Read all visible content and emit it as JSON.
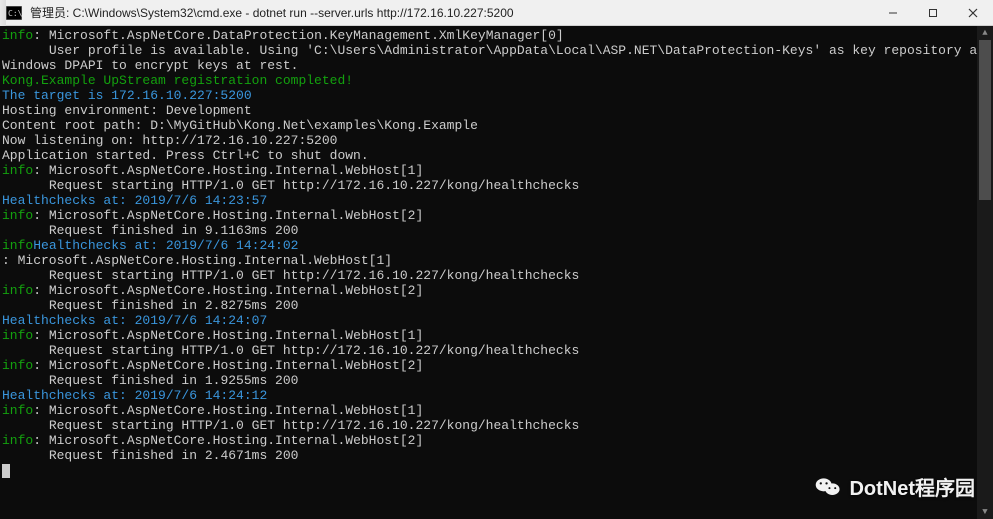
{
  "title": "管理员: C:\\Windows\\System32\\cmd.exe - dotnet  run --server.urls http://172.16.10.227:5200",
  "watermark": "DotNet程序园",
  "lines": [
    {
      "segments": [
        {
          "cls": "lvl-info",
          "txt": "info"
        },
        {
          "cls": "gray",
          "txt": ": Microsoft.AspNetCore.DataProtection.KeyManagement.XmlKeyManager[0]"
        }
      ]
    },
    {
      "segments": [
        {
          "cls": "gray",
          "txt": "      User profile is available. Using 'C:\\Users\\Administrator\\AppData\\Local\\ASP.NET\\DataProtection-Keys' as key repository and Windows DPAPI to encrypt keys at rest."
        }
      ]
    },
    {
      "segments": [
        {
          "cls": "kong-green",
          "txt": "Kong.Example UpStream registration completed!"
        }
      ]
    },
    {
      "segments": [
        {
          "cls": "hc-cyan",
          "txt": "The target is 172.16.10.227:5200"
        }
      ]
    },
    {
      "segments": [
        {
          "cls": "gray",
          "txt": "Hosting environment: Development"
        }
      ]
    },
    {
      "segments": [
        {
          "cls": "gray",
          "txt": "Content root path: D:\\MyGitHub\\Kong.Net\\examples\\Kong.Example"
        }
      ]
    },
    {
      "segments": [
        {
          "cls": "gray",
          "txt": "Now listening on: http://172.16.10.227:5200"
        }
      ]
    },
    {
      "segments": [
        {
          "cls": "gray",
          "txt": "Application started. Press Ctrl+C to shut down."
        }
      ]
    },
    {
      "segments": [
        {
          "cls": "lvl-info",
          "txt": "info"
        },
        {
          "cls": "gray",
          "txt": ": Microsoft.AspNetCore.Hosting.Internal.WebHost[1]"
        }
      ]
    },
    {
      "segments": [
        {
          "cls": "gray",
          "txt": "      Request starting HTTP/1.0 GET http://172.16.10.227/kong/healthchecks"
        }
      ]
    },
    {
      "segments": [
        {
          "cls": "hc-cyan",
          "txt": "Healthchecks at: 2019/7/6 14:23:57"
        }
      ]
    },
    {
      "segments": [
        {
          "cls": "lvl-info",
          "txt": "info"
        },
        {
          "cls": "gray",
          "txt": ": Microsoft.AspNetCore.Hosting.Internal.WebHost[2]"
        }
      ]
    },
    {
      "segments": [
        {
          "cls": "gray",
          "txt": "      Request finished in 9.1163ms 200"
        }
      ]
    },
    {
      "segments": [
        {
          "cls": "gray",
          "txt": ""
        }
      ]
    },
    {
      "segments": [
        {
          "cls": "lvl-info",
          "txt": "info"
        },
        {
          "cls": "hc-cyan",
          "txt": "Healthchecks at: 2019/7/6 14:24:02"
        }
      ]
    },
    {
      "segments": [
        {
          "cls": "gray",
          "txt": ": Microsoft.AspNetCore.Hosting.Internal.WebHost[1]"
        }
      ]
    },
    {
      "segments": [
        {
          "cls": "gray",
          "txt": "      Request starting HTTP/1.0 GET http://172.16.10.227/kong/healthchecks"
        }
      ]
    },
    {
      "segments": [
        {
          "cls": "lvl-info",
          "txt": "info"
        },
        {
          "cls": "gray",
          "txt": ": Microsoft.AspNetCore.Hosting.Internal.WebHost[2]"
        }
      ]
    },
    {
      "segments": [
        {
          "cls": "gray",
          "txt": "      Request finished in 2.8275ms 200"
        }
      ]
    },
    {
      "segments": [
        {
          "cls": "hc-cyan",
          "txt": "Healthchecks at: 2019/7/6 14:24:07"
        }
      ]
    },
    {
      "segments": [
        {
          "cls": "lvl-info",
          "txt": "info"
        },
        {
          "cls": "gray",
          "txt": ": Microsoft.AspNetCore.Hosting.Internal.WebHost[1]"
        }
      ]
    },
    {
      "segments": [
        {
          "cls": "gray",
          "txt": "      Request starting HTTP/1.0 GET http://172.16.10.227/kong/healthchecks"
        }
      ]
    },
    {
      "segments": [
        {
          "cls": "lvl-info",
          "txt": "info"
        },
        {
          "cls": "gray",
          "txt": ": Microsoft.AspNetCore.Hosting.Internal.WebHost[2]"
        }
      ]
    },
    {
      "segments": [
        {
          "cls": "gray",
          "txt": "      Request finished in 1.9255ms 200"
        }
      ]
    },
    {
      "segments": [
        {
          "cls": "hc-cyan",
          "txt": "Healthchecks at: 2019/7/6 14:24:12"
        }
      ]
    },
    {
      "segments": [
        {
          "cls": "lvl-info",
          "txt": "info"
        },
        {
          "cls": "gray",
          "txt": ": Microsoft.AspNetCore.Hosting.Internal.WebHost[1]"
        }
      ]
    },
    {
      "segments": [
        {
          "cls": "gray",
          "txt": "      Request starting HTTP/1.0 GET http://172.16.10.227/kong/healthchecks"
        }
      ]
    },
    {
      "segments": [
        {
          "cls": "lvl-info",
          "txt": "info"
        },
        {
          "cls": "gray",
          "txt": ": Microsoft.AspNetCore.Hosting.Internal.WebHost[2]"
        }
      ]
    },
    {
      "segments": [
        {
          "cls": "gray",
          "txt": "      Request finished in 2.4671ms 200"
        }
      ]
    }
  ]
}
